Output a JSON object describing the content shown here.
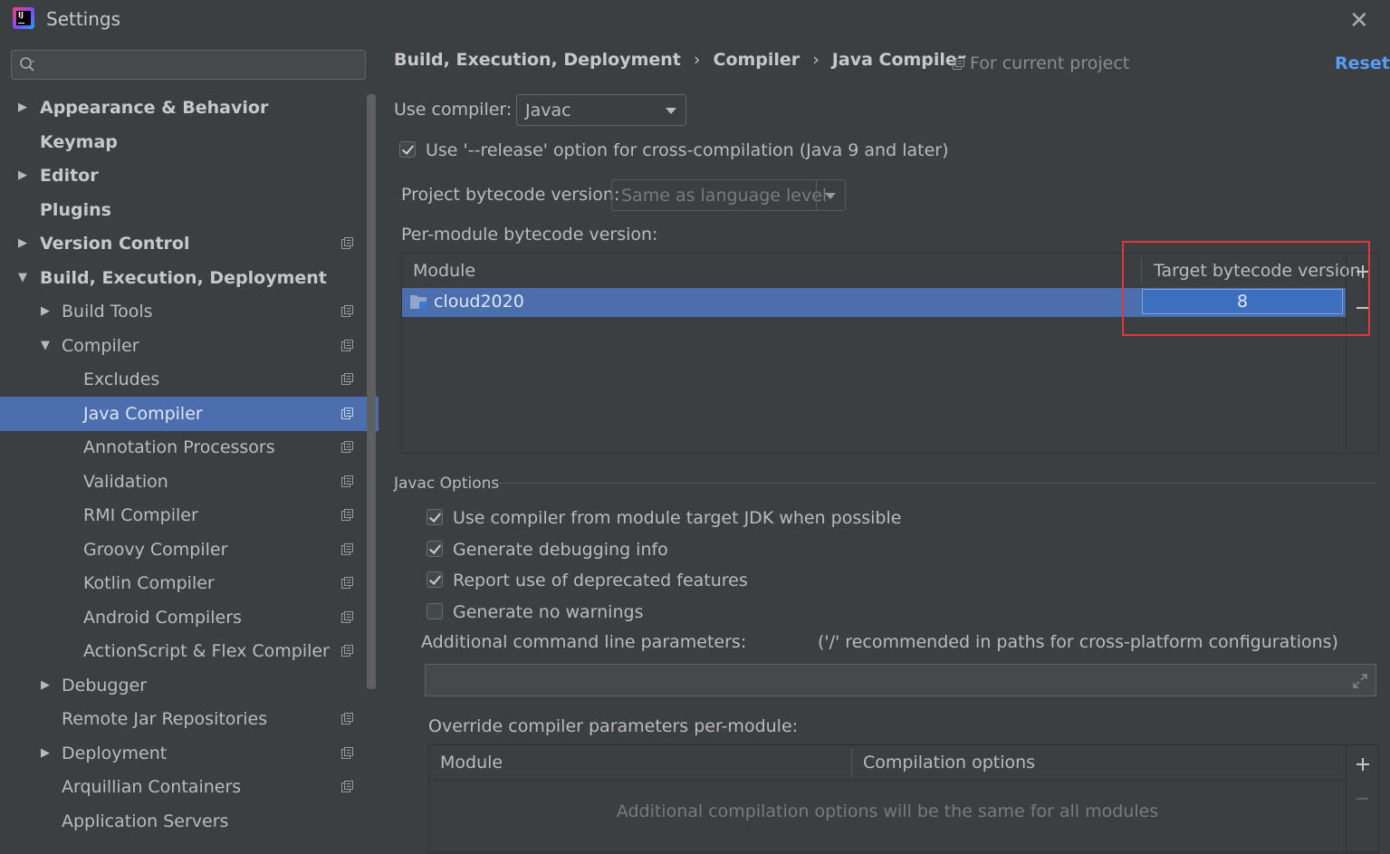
{
  "window": {
    "title": "Settings"
  },
  "search": {
    "placeholder": ""
  },
  "sidebar": {
    "items": [
      {
        "label": "Appearance & Behavior"
      },
      {
        "label": "Keymap"
      },
      {
        "label": "Editor"
      },
      {
        "label": "Plugins"
      },
      {
        "label": "Version Control"
      },
      {
        "label": "Build, Execution, Deployment"
      },
      {
        "label": "Build Tools"
      },
      {
        "label": "Compiler"
      },
      {
        "label": "Excludes"
      },
      {
        "label": "Java Compiler"
      },
      {
        "label": "Annotation Processors"
      },
      {
        "label": "Validation"
      },
      {
        "label": "RMI Compiler"
      },
      {
        "label": "Groovy Compiler"
      },
      {
        "label": "Kotlin Compiler"
      },
      {
        "label": "Android Compilers"
      },
      {
        "label": "ActionScript & Flex Compiler"
      },
      {
        "label": "Debugger"
      },
      {
        "label": "Remote Jar Repositories"
      },
      {
        "label": "Deployment"
      },
      {
        "label": "Arquillian Containers"
      },
      {
        "label": "Application Servers"
      }
    ]
  },
  "header": {
    "breadcrumb": [
      "Build, Execution, Deployment",
      "Compiler",
      "Java Compiler"
    ],
    "separator": "›",
    "scope": "For current project",
    "reset": "Reset"
  },
  "compiler": {
    "use_compiler_label": "Use compiler:",
    "use_compiler_value": "Javac",
    "release_option_label": "Use '--release' option for cross-compilation (Java 9 and later)",
    "project_bytecode_label": "Project bytecode version:",
    "project_bytecode_value": "Same as language level",
    "per_module_label": "Per-module bytecode version:"
  },
  "module_table": {
    "columns": [
      "Module",
      "Target bytecode version"
    ],
    "rows": [
      {
        "module": "cloud2020",
        "target": "8"
      }
    ]
  },
  "javac": {
    "section_title": "Javac Options",
    "options": [
      {
        "label": "Use compiler from module target JDK when possible",
        "checked": true
      },
      {
        "label": "Generate debugging info",
        "checked": true
      },
      {
        "label": "Report use of deprecated features",
        "checked": true
      },
      {
        "label": "Generate no warnings",
        "checked": false
      }
    ],
    "additional_label": "Additional command line parameters:",
    "additional_hint": "('/' recommended in paths for cross-platform configurations)",
    "additional_value": ""
  },
  "override": {
    "label": "Override compiler parameters per-module:",
    "columns": [
      "Module",
      "Compilation options"
    ],
    "empty_text": "Additional compilation options will be the same for all modules"
  },
  "colors": {
    "selection": "#4b6eaf",
    "link": "#589df6",
    "highlight_box": "#e0373c",
    "background": "#3c3f41"
  }
}
